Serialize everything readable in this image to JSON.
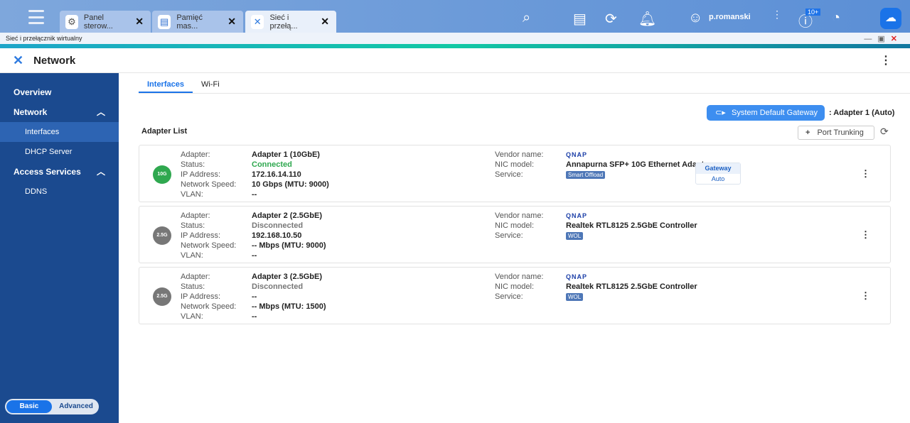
{
  "taskbar": {
    "tabs": [
      {
        "label": "Panel sterow...",
        "icon": "gear-icon"
      },
      {
        "label": "Pamięć mas...",
        "icon": "storage-icon"
      },
      {
        "label": "Sieć i przełą...",
        "icon": "network-icon"
      }
    ],
    "user": "p.romanski",
    "notifications_badge": "10+"
  },
  "window": {
    "title": "Sieć i przełącznik wirtualny"
  },
  "app": {
    "title": "Network"
  },
  "sidebar": {
    "items": [
      {
        "label": "Overview"
      },
      {
        "label": "Network"
      },
      {
        "label": "Interfaces"
      },
      {
        "label": "DHCP Server"
      },
      {
        "label": "Access Services"
      },
      {
        "label": "DDNS"
      }
    ],
    "mode": {
      "basic": "Basic",
      "advanced": "Advanced"
    }
  },
  "tabs": [
    "Interfaces",
    "Wi-Fi"
  ],
  "gateway": {
    "button": "System Default Gateway",
    "value": ": Adapter 1 (Auto)"
  },
  "adapter_list": {
    "title": "Adapter List",
    "port_trunking": "Port Trunking"
  },
  "labels": {
    "adapter": "Adapter:",
    "status": "Status:",
    "ip": "IP Address:",
    "speed": "Network Speed:",
    "vlan": "VLAN:",
    "vendor": "Vendor name:",
    "nic": "NIC model:",
    "service": "Service:"
  },
  "adapters": [
    {
      "badge": "10G",
      "name": "Adapter 1 (10GbE)",
      "status": "Connected",
      "ip": "172.16.14.110",
      "speed": "10 Gbps (MTU: 9000)",
      "vlan": "--",
      "vendor": "QNAP",
      "nic": "Annapurna SFP+ 10G Ethernet Adapter",
      "service": "Smart Offload",
      "gateway": "Gateway",
      "gateway_mode": "Auto"
    },
    {
      "badge": "2.5G",
      "name": "Adapter 2 (2.5GbE)",
      "status": "Disconnected",
      "ip": "192.168.10.50",
      "speed": "-- Mbps (MTU: 9000)",
      "vlan": "--",
      "vendor": "QNAP",
      "nic": "Realtek RTL8125 2.5GbE Controller",
      "service": "WOL"
    },
    {
      "badge": "2.5G",
      "name": "Adapter 3 (2.5GbE)",
      "status": "Disconnected",
      "ip": "--",
      "speed": "-- Mbps (MTU: 1500)",
      "vlan": "--",
      "vendor": "QNAP",
      "nic": "Realtek RTL8125 2.5GbE Controller",
      "service": "WOL"
    }
  ],
  "colors": {
    "connected": "#2fa84f",
    "disconnected": "#777777",
    "accent": "#1a73e8",
    "sidebar": "#1b4a8f"
  }
}
